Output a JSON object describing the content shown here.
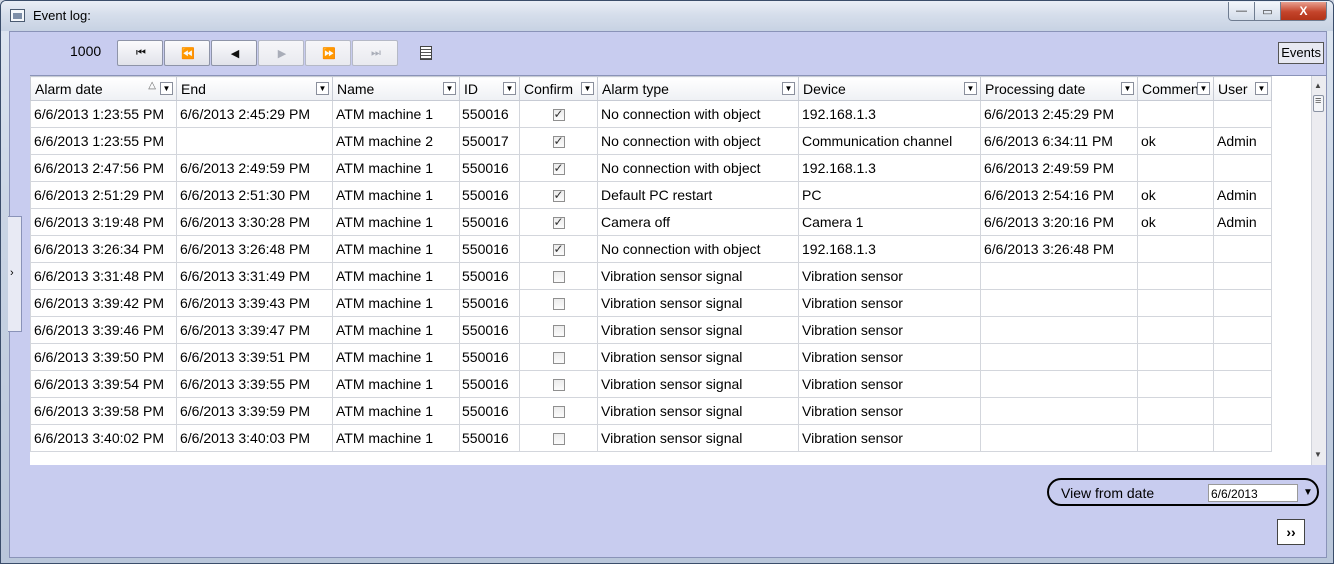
{
  "window": {
    "title": "Event log:",
    "minimize_glyph": "—",
    "maximize_glyph": "▭",
    "close_glyph": "X"
  },
  "toolbar": {
    "count": "1000",
    "buttons": [
      {
        "name": "first-page-button",
        "glyph": "⏮",
        "icon": "skip-to-first-icon",
        "enabled": true
      },
      {
        "name": "prev-block-button",
        "glyph": "⏪",
        "icon": "rewind-icon",
        "enabled": true
      },
      {
        "name": "prev-button",
        "glyph": "◀",
        "icon": "step-back-icon",
        "enabled": true
      },
      {
        "name": "next-button",
        "glyph": "▶",
        "icon": "step-forward-icon",
        "enabled": false
      },
      {
        "name": "next-block-button",
        "glyph": "⏩",
        "icon": "fast-forward-icon",
        "enabled": false
      },
      {
        "name": "last-page-button",
        "glyph": "⏭",
        "icon": "skip-to-last-icon",
        "enabled": false
      }
    ],
    "events_label": "Events"
  },
  "table": {
    "columns": [
      {
        "key": "alarm_date",
        "label": "Alarm date",
        "sorted": true
      },
      {
        "key": "end",
        "label": "End"
      },
      {
        "key": "name",
        "label": "Name"
      },
      {
        "key": "id",
        "label": "ID"
      },
      {
        "key": "confirm",
        "label": "Confirm"
      },
      {
        "key": "alarm_type",
        "label": "Alarm type"
      },
      {
        "key": "device",
        "label": "Device"
      },
      {
        "key": "processing_date",
        "label": "Processing date"
      },
      {
        "key": "comment",
        "label": "Comment"
      },
      {
        "key": "user",
        "label": "User"
      }
    ],
    "sort_glyph": "△",
    "dropdown_glyph": "▼",
    "rows": [
      {
        "alarm_date": "6/6/2013 1:23:55 PM",
        "end": "6/6/2013 2:45:29 PM",
        "name": "ATM machine 1",
        "id": "550016",
        "confirm": true,
        "alarm_type": "No connection with object",
        "device": "192.168.1.3",
        "processing_date": "6/6/2013 2:45:29 PM",
        "comment": "",
        "user": ""
      },
      {
        "alarm_date": "6/6/2013 1:23:55 PM",
        "end": "",
        "name": "ATM machine 2",
        "id": "550017",
        "confirm": true,
        "alarm_type": "No connection with object",
        "device": "Communication channel",
        "processing_date": "6/6/2013 6:34:11 PM",
        "comment": "ok",
        "user": "Admin"
      },
      {
        "alarm_date": "6/6/2013 2:47:56 PM",
        "end": "6/6/2013 2:49:59 PM",
        "name": "ATM machine 1",
        "id": "550016",
        "confirm": true,
        "alarm_type": "No connection with object",
        "device": "192.168.1.3",
        "processing_date": "6/6/2013 2:49:59 PM",
        "comment": "",
        "user": ""
      },
      {
        "alarm_date": "6/6/2013 2:51:29 PM",
        "end": "6/6/2013 2:51:30 PM",
        "name": "ATM machine 1",
        "id": "550016",
        "confirm": true,
        "alarm_type": "Default PC restart",
        "device": "PC",
        "processing_date": "6/6/2013 2:54:16 PM",
        "comment": "ok",
        "user": "Admin"
      },
      {
        "alarm_date": "6/6/2013 3:19:48 PM",
        "end": "6/6/2013 3:30:28 PM",
        "name": "ATM machine 1",
        "id": "550016",
        "confirm": true,
        "alarm_type": "Camera off",
        "device": "Camera 1",
        "processing_date": "6/6/2013 3:20:16 PM",
        "comment": "ok",
        "user": "Admin"
      },
      {
        "alarm_date": "6/6/2013 3:26:34 PM",
        "end": "6/6/2013 3:26:48 PM",
        "name": "ATM machine 1",
        "id": "550016",
        "confirm": true,
        "alarm_type": "No connection with object",
        "device": "192.168.1.3",
        "processing_date": "6/6/2013 3:26:48 PM",
        "comment": "",
        "user": ""
      },
      {
        "alarm_date": "6/6/2013 3:31:48 PM",
        "end": "6/6/2013 3:31:49 PM",
        "name": "ATM machine 1",
        "id": "550016",
        "confirm": false,
        "alarm_type": "Vibration sensor signal",
        "device": "Vibration sensor",
        "processing_date": "",
        "comment": "",
        "user": ""
      },
      {
        "alarm_date": "6/6/2013 3:39:42 PM",
        "end": "6/6/2013 3:39:43 PM",
        "name": "ATM machine 1",
        "id": "550016",
        "confirm": false,
        "alarm_type": "Vibration sensor signal",
        "device": "Vibration sensor",
        "processing_date": "",
        "comment": "",
        "user": ""
      },
      {
        "alarm_date": "6/6/2013 3:39:46 PM",
        "end": "6/6/2013 3:39:47 PM",
        "name": "ATM machine 1",
        "id": "550016",
        "confirm": false,
        "alarm_type": "Vibration sensor signal",
        "device": "Vibration sensor",
        "processing_date": "",
        "comment": "",
        "user": ""
      },
      {
        "alarm_date": "6/6/2013 3:39:50 PM",
        "end": "6/6/2013 3:39:51 PM",
        "name": "ATM machine 1",
        "id": "550016",
        "confirm": false,
        "alarm_type": "Vibration sensor signal",
        "device": "Vibration sensor",
        "processing_date": "",
        "comment": "",
        "user": ""
      },
      {
        "alarm_date": "6/6/2013 3:39:54 PM",
        "end": "6/6/2013 3:39:55 PM",
        "name": "ATM machine 1",
        "id": "550016",
        "confirm": false,
        "alarm_type": "Vibration sensor signal",
        "device": "Vibration sensor",
        "processing_date": "",
        "comment": "",
        "user": ""
      },
      {
        "alarm_date": "6/6/2013 3:39:58 PM",
        "end": "6/6/2013 3:39:59 PM",
        "name": "ATM machine 1",
        "id": "550016",
        "confirm": false,
        "alarm_type": "Vibration sensor signal",
        "device": "Vibration sensor",
        "processing_date": "",
        "comment": "",
        "user": ""
      },
      {
        "alarm_date": "6/6/2013 3:40:02 PM",
        "end": "6/6/2013 3:40:03 PM",
        "name": "ATM machine 1",
        "id": "550016",
        "confirm": false,
        "alarm_type": "Vibration sensor signal",
        "device": "Vibration sensor",
        "processing_date": "",
        "comment": "",
        "user": ""
      }
    ]
  },
  "scrollbar": {
    "up_glyph": "▲",
    "down_glyph": "▼"
  },
  "collapse_glyph": "›",
  "view_from": {
    "label": "View from date",
    "value": "6/6/2013",
    "arrow_glyph": "▼"
  },
  "next_label": "››"
}
